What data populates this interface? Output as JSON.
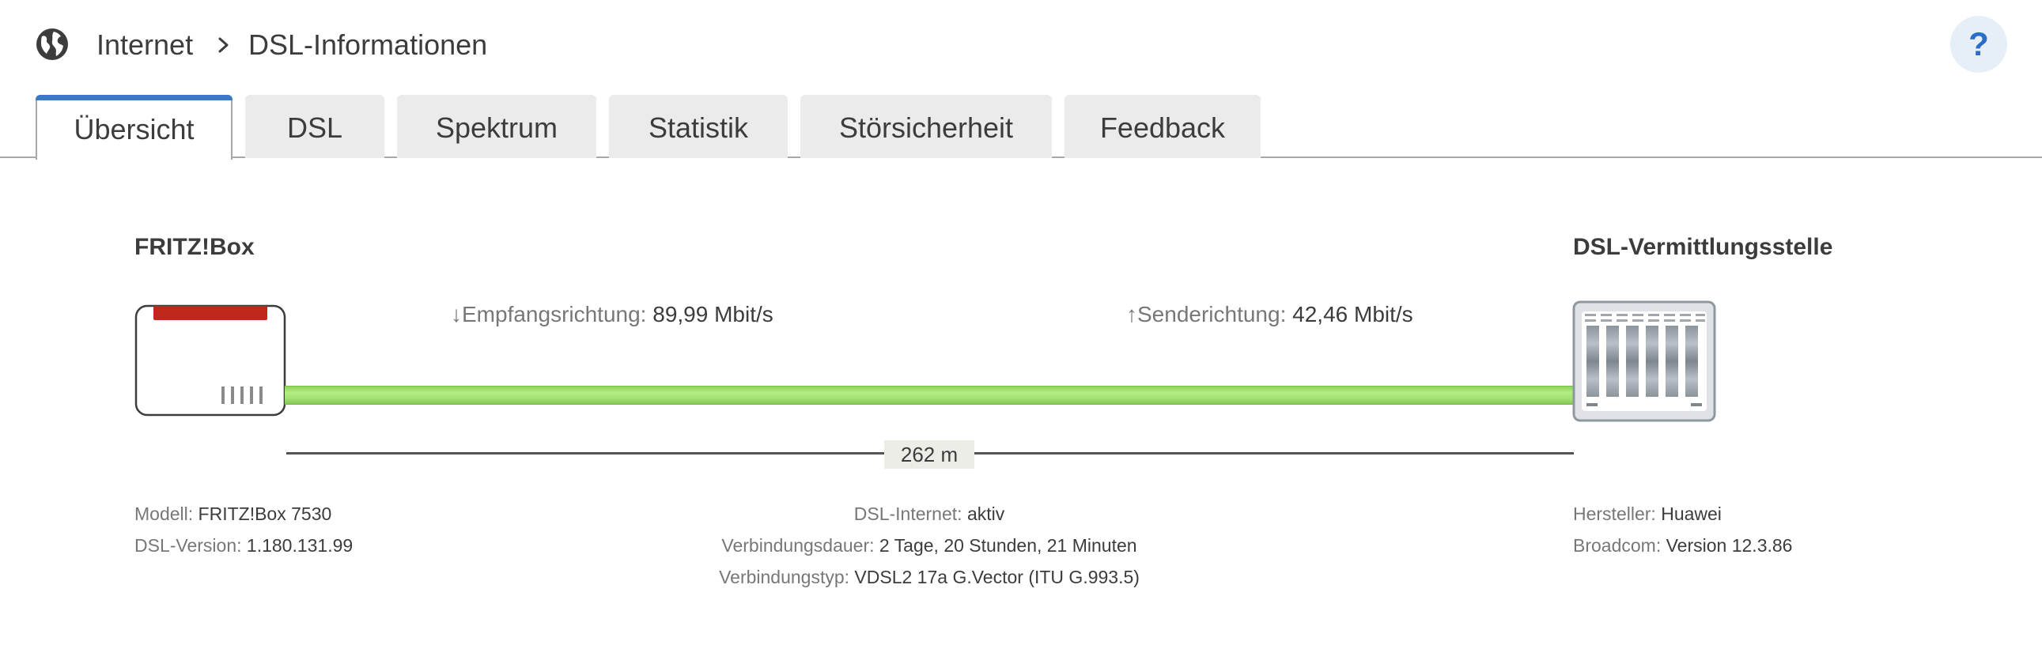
{
  "breadcrumb": {
    "section": "Internet",
    "page": "DSL-Informationen",
    "separator": "chevron-right-icon"
  },
  "help": {
    "label": "?"
  },
  "tabs": [
    {
      "label": "Übersicht",
      "active": true
    },
    {
      "label": "DSL",
      "active": false
    },
    {
      "label": "Spektrum",
      "active": false
    },
    {
      "label": "Statistik",
      "active": false
    },
    {
      "label": "Störsicherheit",
      "active": false
    },
    {
      "label": "Feedback",
      "active": false
    }
  ],
  "local": {
    "title": "FRITZ!Box",
    "icon": "router-icon"
  },
  "remote": {
    "title": "DSL-Vermittlungsstelle",
    "icon": "exchange-rack-icon"
  },
  "downstream": {
    "arrow": "↓",
    "label": "Empfangsrichtung:",
    "value": "89,99 Mbit/s"
  },
  "upstream": {
    "arrow": "↑",
    "label": "Senderichtung:",
    "value": "42,46 Mbit/s"
  },
  "distance": {
    "value": "262 m"
  },
  "left_info": [
    {
      "label": "Modell:",
      "value": "FRITZ!Box 7530"
    },
    {
      "label": "DSL-Version:",
      "value": "1.180.131.99"
    }
  ],
  "center_info": [
    {
      "label": "DSL-Internet:",
      "value": "aktiv"
    },
    {
      "label": "Verbindungsdauer:",
      "value": "2 Tage, 20 Stunden, 21 Minuten"
    },
    {
      "label": "Verbindungstyp:",
      "value": "VDSL2 17a G.Vector (ITU G.993.5)"
    }
  ],
  "right_info": [
    {
      "label": "Hersteller:",
      "value": "Huawei"
    },
    {
      "label": "Broadcom:",
      "value": "Version 12.3.86"
    }
  ],
  "colors": {
    "accent": "#3a78c9",
    "line_green": "#a6e374",
    "router_red": "#c0281e",
    "help_bg": "#e6eef7"
  }
}
